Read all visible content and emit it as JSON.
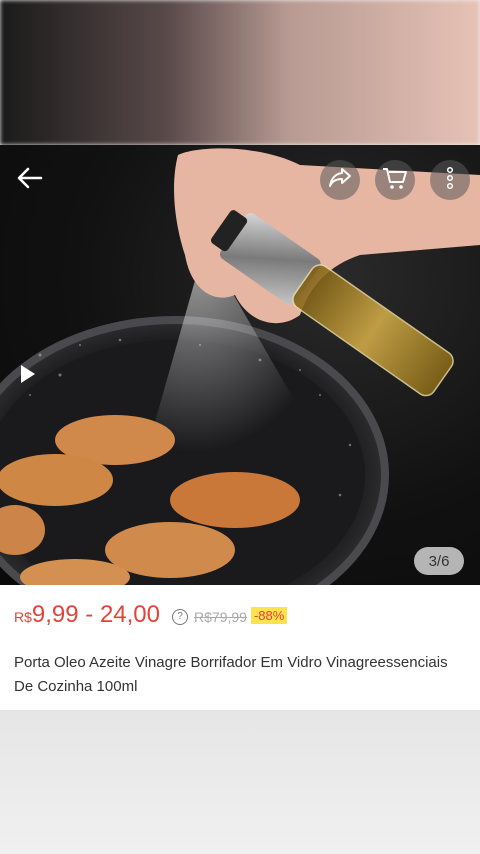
{
  "product": {
    "image_counter": "3/6",
    "price_currency": "R$",
    "price_range": "9,99 - 24,00",
    "original_price": "R$79,99",
    "discount": "-88%",
    "help_icon_glyph": "?",
    "title": "Porta Oleo Azeite Vinagre Borrifador Em Vidro Vinagreessenciais De Cozinha 100ml"
  },
  "icons": {
    "back": "arrow-left-icon",
    "share": "share-icon",
    "cart": "cart-icon",
    "more": "more-vertical-icon",
    "play": "play-icon"
  },
  "colors": {
    "price": "#e0443a",
    "discount_bg": "#ffe34d"
  }
}
